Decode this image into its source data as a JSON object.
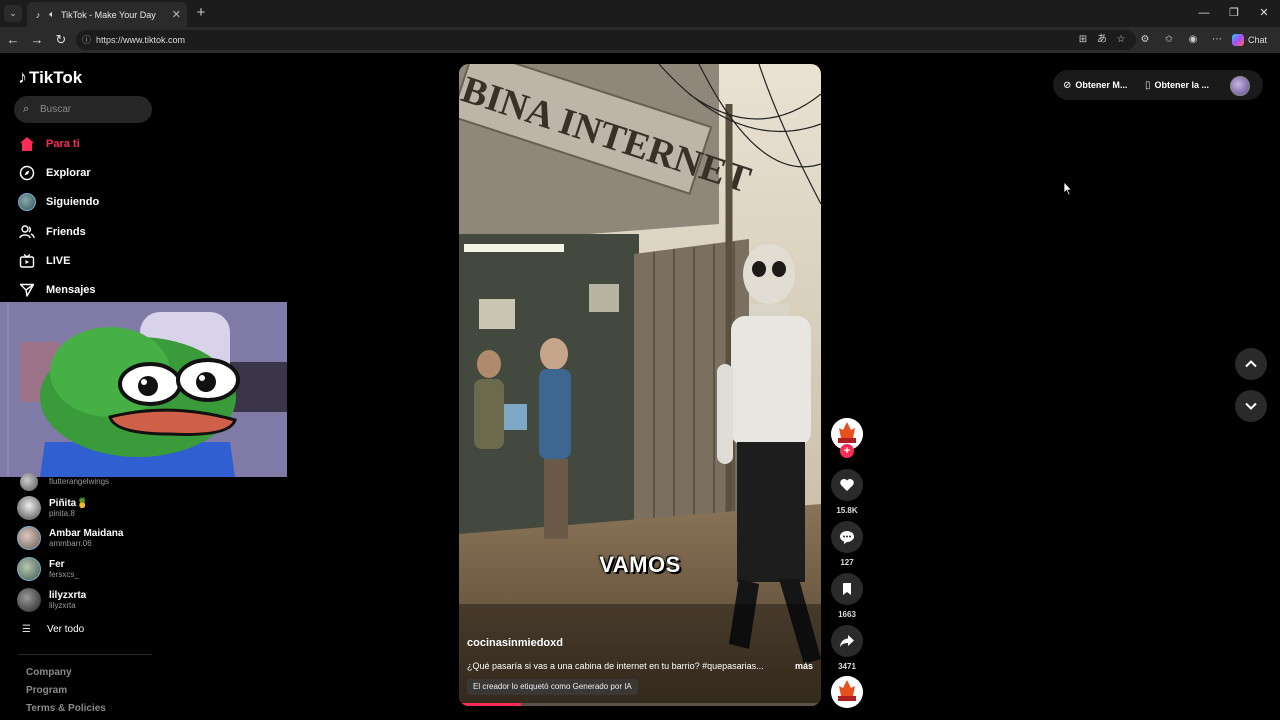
{
  "browser": {
    "tab_title": "TikTok - Make Your Day",
    "url": "https://www.tiktok.com",
    "chat_label": "Chat"
  },
  "sidebar": {
    "logo": "TikTok",
    "search_placeholder": "Buscar",
    "nav": [
      {
        "label": "Para ti",
        "icon": "home-icon",
        "active": true
      },
      {
        "label": "Explorar",
        "icon": "compass-icon",
        "active": false
      },
      {
        "label": "Siguiendo",
        "icon": "avatar-icon",
        "active": false
      },
      {
        "label": "Friends",
        "icon": "friends-icon",
        "active": false
      },
      {
        "label": "LIVE",
        "icon": "live-icon",
        "active": false
      },
      {
        "label": "Mensajes",
        "icon": "send-icon",
        "active": false
      }
    ],
    "following": [
      {
        "name": "",
        "handle": "flutterangelwings"
      },
      {
        "name": "Piñita🍍",
        "handle": "pinita.8"
      },
      {
        "name": "Ambar Maidana",
        "handle": "ammbarr.06"
      },
      {
        "name": "Fer",
        "handle": "fersxcs_"
      },
      {
        "name": "lilyzxrta",
        "handle": "lilyzxrta"
      }
    ],
    "see_all": "Ver todo",
    "footer": [
      "Company",
      "Program",
      "Terms & Policies"
    ]
  },
  "video": {
    "overlay_text": "VAMOS",
    "author": "cocinasinmiedoxd",
    "description": "¿Qué pasaría si vas a una cabina de internet en tu barrio? #quepasarias...",
    "more": "más",
    "ai_label": "El creador lo etiquetó como Generado por IA",
    "sign_text": "CABINA INTERNET",
    "progress": 0.17
  },
  "actions": {
    "likes": "15.8K",
    "comments": "127",
    "saves": "1663",
    "shares": "3471"
  },
  "topbar": {
    "get_coins": "Obtener M...",
    "get_app": "Obtener la ..."
  },
  "colors": {
    "accent": "#fe2c55",
    "background": "#000000"
  }
}
